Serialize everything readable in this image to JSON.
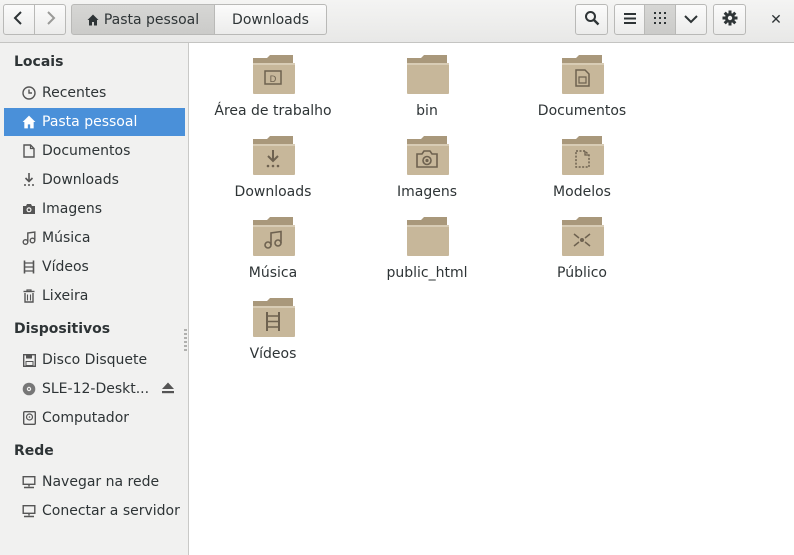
{
  "header": {
    "breadcrumbs": [
      "Pasta pessoal",
      "Downloads"
    ],
    "icons": {
      "back": "go-back-icon",
      "forward": "go-forward-icon",
      "search": "search-icon",
      "list_view": "list-view-icon",
      "grid_view": "grid-view-icon",
      "view_menu": "chevron-down-icon",
      "settings": "gear-icon",
      "close": "close-icon"
    },
    "close_glyph": "✕"
  },
  "sidebar": {
    "sections": [
      {
        "title": "Locais",
        "items": [
          {
            "label": "Recentes",
            "icon": "clock-icon"
          },
          {
            "label": "Pasta pessoal",
            "icon": "home-icon",
            "selected": true
          },
          {
            "label": "Documentos",
            "icon": "document-icon"
          },
          {
            "label": "Downloads",
            "icon": "download-icon"
          },
          {
            "label": "Imagens",
            "icon": "camera-icon"
          },
          {
            "label": "Música",
            "icon": "music-icon"
          },
          {
            "label": "Vídeos",
            "icon": "film-icon"
          },
          {
            "label": "Lixeira",
            "icon": "trash-icon"
          }
        ]
      },
      {
        "title": "Dispositivos",
        "items": [
          {
            "label": "Disco Disquete",
            "icon": "floppy-icon"
          },
          {
            "label": "SLE-12-Deskt...",
            "icon": "optical-disc-icon",
            "eject": true
          },
          {
            "label": "Computador",
            "icon": "computer-icon"
          }
        ]
      },
      {
        "title": "Rede",
        "items": [
          {
            "label": "Navegar na rede",
            "icon": "network-icon"
          },
          {
            "label": "Conectar a servidor",
            "icon": "server-icon"
          }
        ]
      }
    ]
  },
  "files": [
    {
      "name": "Área de trabalho",
      "emblem": "desktop"
    },
    {
      "name": "bin",
      "emblem": "none"
    },
    {
      "name": "Documentos",
      "emblem": "document"
    },
    {
      "name": "Downloads",
      "emblem": "download"
    },
    {
      "name": "Imagens",
      "emblem": "camera"
    },
    {
      "name": "Modelos",
      "emblem": "template"
    },
    {
      "name": "Música",
      "emblem": "music"
    },
    {
      "name": "public_html",
      "emblem": "none"
    },
    {
      "name": "Público",
      "emblem": "share"
    },
    {
      "name": "Vídeos",
      "emblem": "film"
    }
  ],
  "colors": {
    "selection": "#4a90d9",
    "folder_body": "#c7b79a",
    "folder_dark": "#a9987b",
    "emblem": "#6e6250"
  }
}
